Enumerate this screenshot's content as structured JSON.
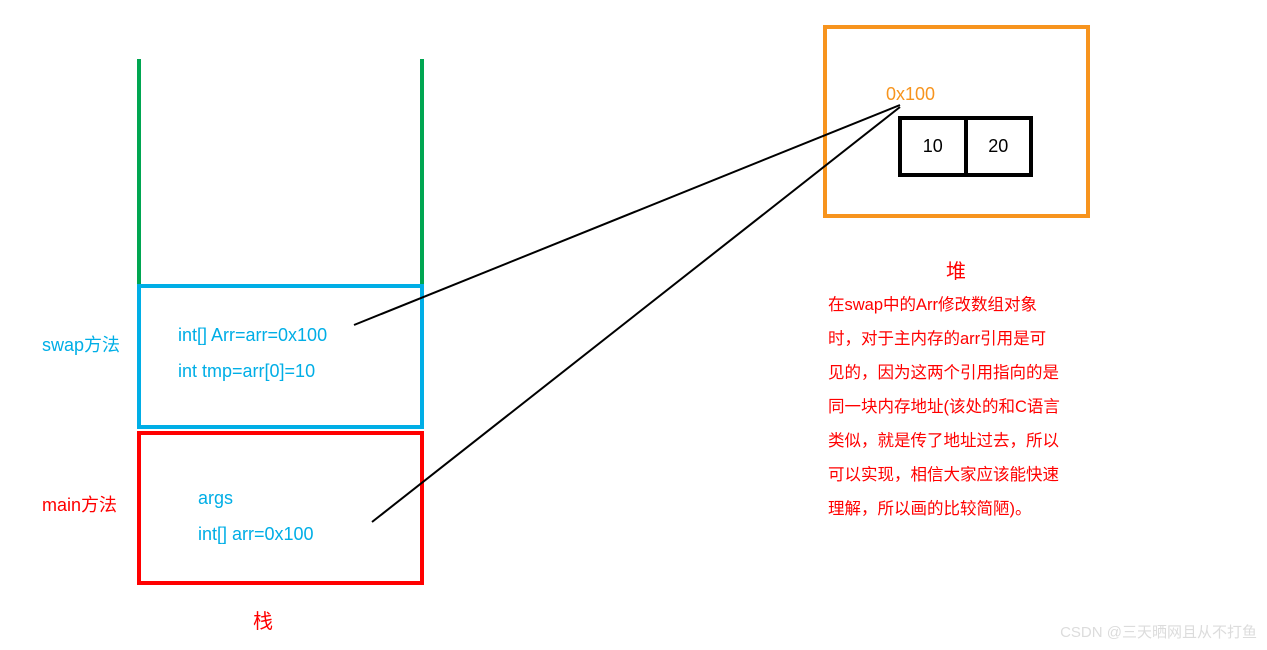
{
  "stack": {
    "swap": {
      "label": "swap方法",
      "line1": "int[] Arr=arr=0x100",
      "line2": "int tmp=arr[0]=10"
    },
    "main": {
      "label": "main方法",
      "line1": "args",
      "line2": "int[] arr=0x100"
    },
    "title": "栈"
  },
  "heap": {
    "title": "堆",
    "address": "0x100",
    "cells": [
      "10",
      "20"
    ]
  },
  "explanation": "在swap中的Arr修改数组对象时，对于主内存的arr引用是可见的，因为这两个引用指向的是同一块内存地址(该处的和C语言类似，就是传了地址过去，所以可以实现，相信大家应该能快速理解，所以画的比较简陋)。",
  "watermark": "CSDN @三天晒网且从不打鱼",
  "chart_data": {
    "type": "diagram",
    "nodes": [
      {
        "id": "stack-swap",
        "label": "swap frame",
        "vars": [
          "int[] Arr=arr=0x100",
          "int tmp=arr[0]=10"
        ]
      },
      {
        "id": "stack-main",
        "label": "main frame",
        "vars": [
          "args",
          "int[] arr=0x100"
        ]
      },
      {
        "id": "heap-array",
        "label": "0x100",
        "values": [
          10,
          20
        ]
      }
    ],
    "edges": [
      {
        "from": "stack-swap",
        "to": "heap-array",
        "via": "0x100"
      },
      {
        "from": "stack-main",
        "to": "heap-array",
        "via": "0x100"
      }
    ]
  }
}
